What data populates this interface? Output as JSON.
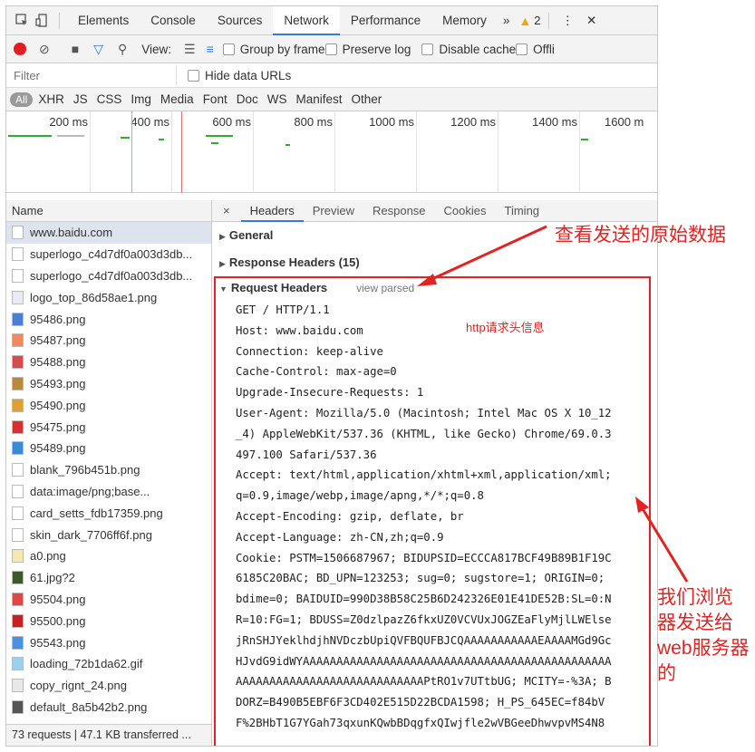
{
  "topbar": {
    "tabs": [
      "Elements",
      "Console",
      "Sources",
      "Network",
      "Performance",
      "Memory"
    ],
    "more": "»",
    "warnings": "2",
    "menu": "⋮",
    "close": "✕"
  },
  "toolbar": {
    "view_label": "View:",
    "group_by_frame": "Group by frame",
    "preserve_log": "Preserve log",
    "disable_cache": "Disable cache",
    "offline": "Offli"
  },
  "filter": {
    "placeholder": "Filter",
    "hide_data_urls": "Hide data URLs",
    "types": [
      "All",
      "XHR",
      "JS",
      "CSS",
      "Img",
      "Media",
      "Font",
      "Doc",
      "WS",
      "Manifest",
      "Other"
    ]
  },
  "timeline": {
    "ticks": [
      "200 ms",
      "400 ms",
      "600 ms",
      "800 ms",
      "1000 ms",
      "1200 ms",
      "1400 ms",
      "1600 m"
    ]
  },
  "requests": {
    "column": "Name",
    "items": [
      {
        "name": "www.baidu.com",
        "icon": "document-icon",
        "color": "#ffffff"
      },
      {
        "name": "superlogo_c4d7df0a003d3db...",
        "icon": "document-icon",
        "color": "#ffffff"
      },
      {
        "name": "superlogo_c4d7df0a003d3db...",
        "icon": "document-icon",
        "color": "#ffffff"
      },
      {
        "name": "logo_top_86d58ae1.png",
        "icon": "image-icon",
        "color": "#e7ecf4"
      },
      {
        "name": "95486.png",
        "icon": "image-icon",
        "color": "#4a7fd6"
      },
      {
        "name": "95487.png",
        "icon": "image-icon",
        "color": "#f08a5d"
      },
      {
        "name": "95488.png",
        "icon": "image-icon",
        "color": "#d94a4a"
      },
      {
        "name": "95493.png",
        "icon": "image-icon",
        "color": "#b88a3a"
      },
      {
        "name": "95490.png",
        "icon": "image-icon",
        "color": "#e0a030"
      },
      {
        "name": "95475.png",
        "icon": "image-icon",
        "color": "#d83030"
      },
      {
        "name": "95489.png",
        "icon": "image-icon",
        "color": "#3a8ad8"
      },
      {
        "name": "blank_796b451b.png",
        "icon": "document-icon",
        "color": "#ffffff"
      },
      {
        "name": "data:image/png;base...",
        "icon": "document-icon",
        "color": "#ffffff"
      },
      {
        "name": "card_setts_fdb17359.png",
        "icon": "document-icon",
        "color": "#ffffff"
      },
      {
        "name": "skin_dark_7706ff6f.png",
        "icon": "document-icon",
        "color": "#ffffff"
      },
      {
        "name": "a0.png",
        "icon": "image-icon",
        "color": "#f5e8b0"
      },
      {
        "name": "61.jpg?2",
        "icon": "image-icon",
        "color": "#3a5a2a"
      },
      {
        "name": "95504.png",
        "icon": "image-icon",
        "color": "#e04848"
      },
      {
        "name": "95500.png",
        "icon": "image-icon",
        "color": "#c82020"
      },
      {
        "name": "95543.png",
        "icon": "image-icon",
        "color": "#4a90e0"
      },
      {
        "name": "loading_72b1da62.gif",
        "icon": "image-icon",
        "color": "#9ad0f0"
      },
      {
        "name": "copy_rignt_24.png",
        "icon": "image-icon",
        "color": "#e8e8e8"
      },
      {
        "name": "default_8a5b42b2.png",
        "icon": "image-icon",
        "color": "#555555"
      }
    ],
    "status": "73 requests | 47.1 KB transferred ..."
  },
  "details": {
    "close": "×",
    "tabs": [
      "Headers",
      "Preview",
      "Response",
      "Cookies",
      "Timing"
    ],
    "general": "General",
    "response_headers": "Response Headers (15)",
    "request_headers": "Request Headers",
    "view_parsed": "view parsed",
    "http_note": "http请求头信息",
    "raw_lines": [
      "GET / HTTP/1.1",
      "Host: www.baidu.com",
      "Connection: keep-alive",
      "Cache-Control: max-age=0",
      "Upgrade-Insecure-Requests: 1",
      "User-Agent: Mozilla/5.0 (Macintosh; Intel Mac OS X 10_12",
      "_4) AppleWebKit/537.36 (KHTML, like Gecko) Chrome/69.0.3",
      "497.100 Safari/537.36",
      "Accept: text/html,application/xhtml+xml,application/xml;",
      "q=0.9,image/webp,image/apng,*/*;q=0.8",
      "Accept-Encoding: gzip, deflate, br",
      "Accept-Language: zh-CN,zh;q=0.9",
      "Cookie: PSTM=1506687967; BIDUPSID=ECCCA817BCF49B89B1F19C",
      "6185C20BAC; BD_UPN=123253; sug=0; sugstore=1; ORIGIN=0;",
      "bdime=0; BAIDUID=990D38B58C25B6D242326E01E41DE52B:SL=0:N",
      "R=10:FG=1; BDUSS=Z0dzlpazZ6fkxUZ0VCVUxJOGZEaFlyMjlLWElse",
      "jRnSHJYeklhdjhNVDczbUpiQVFBQUFBJCQAAAAAAAAAAAEAAAAMGd9Gc",
      "HJvdG9idWYAAAAAAAAAAAAAAAAAAAAAAAAAAAAAAAAAAAAAAAAAAAAAA",
      "AAAAAAAAAAAAAAAAAAAAAAAAAAAAPtRO1v7UTtbUG; MCITY=-%3A; B",
      "DORZ=B490B5EBF6F3CD402E515D22BCDA1598; H_PS_645EC=f84bV",
      "F%2BHbT1G7YGah73qxunKQwbBDqgfxQIwjfle2wVBGeeDhwvpvMS4N8"
    ]
  },
  "annotations": {
    "view_raw": "查看发送的原始数据",
    "sent_to_server": "我们浏览器发送给web服务器的"
  },
  "colors": {
    "accent": "#3879d9",
    "annotation": "#e02323",
    "record": "#e02020"
  }
}
